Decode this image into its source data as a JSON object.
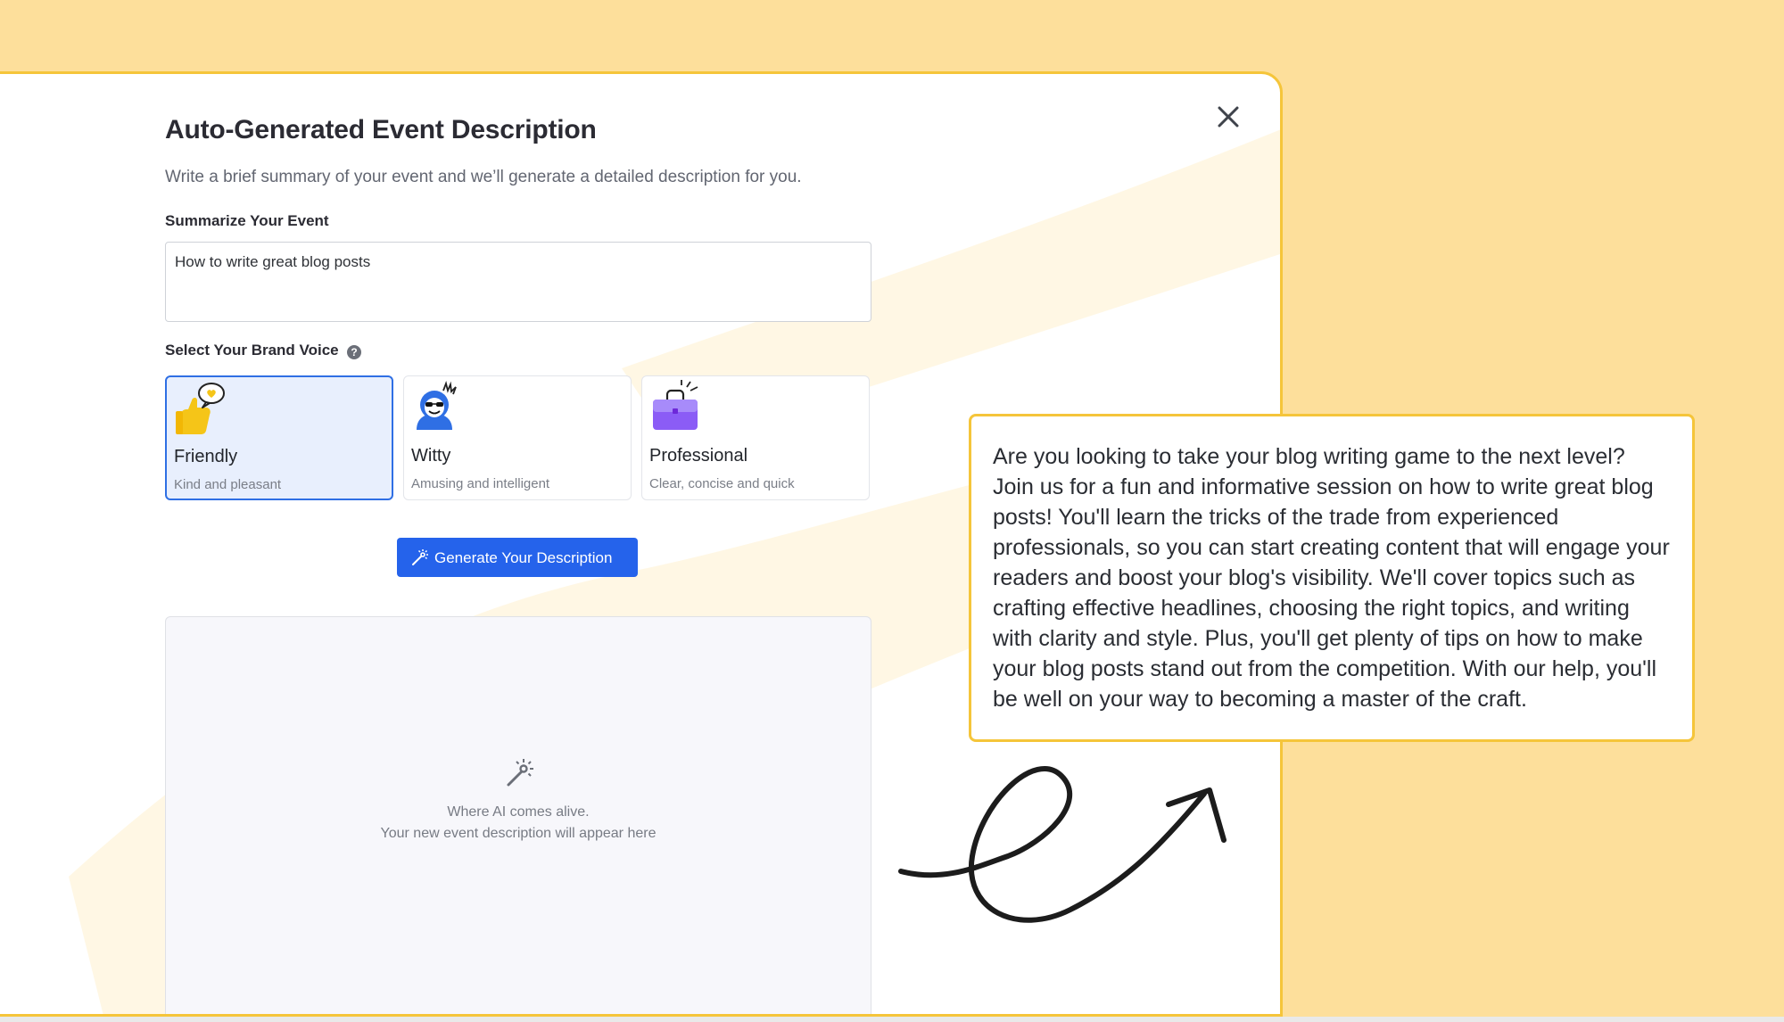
{
  "modal": {
    "title": "Auto-Generated Event Description",
    "subtitle": "Write a brief summary of your event and we’ll generate a detailed description for you.",
    "summary_label": "Summarize Your Event",
    "summary_value": "How to write great blog posts",
    "voice_label": "Select Your Brand Voice",
    "help_glyph": "?",
    "voices": [
      {
        "title": "Friendly",
        "description": "Kind and pleasant",
        "selected": true,
        "icon": "thumbs-up-heart-icon"
      },
      {
        "title": "Witty",
        "description": "Amusing and intelligent",
        "selected": false,
        "icon": "cool-face-icon"
      },
      {
        "title": "Professional",
        "description": "Clear, concise and quick",
        "selected": false,
        "icon": "briefcase-icon"
      }
    ],
    "generate_label": "Generate Your Description",
    "output_placeholder_line1": "Where AI comes alive.",
    "output_placeholder_line2": "Your new event description will appear here"
  },
  "callout": {
    "text": "Are you looking to take your blog writing game to the next level? Join us for a fun and informative session on how to write great blog posts! You'll learn the tricks of the trade from experienced professionals, so you can start creating content that will engage your readers and boost your blog's visibility. We'll cover topics such as crafting effective headlines, choosing the right topics, and writing with clarity and style. Plus, you'll get plenty of tips on how to make your blog posts stand out from the competition. With our help, you'll be well on your way to becoming a master of the craft."
  },
  "colors": {
    "page_background": "#fddf9b",
    "accent_border": "#f5c53a",
    "primary_button": "#2563eb",
    "selected_card_bg": "#e8effd",
    "selected_card_border": "#2f6fe4"
  }
}
